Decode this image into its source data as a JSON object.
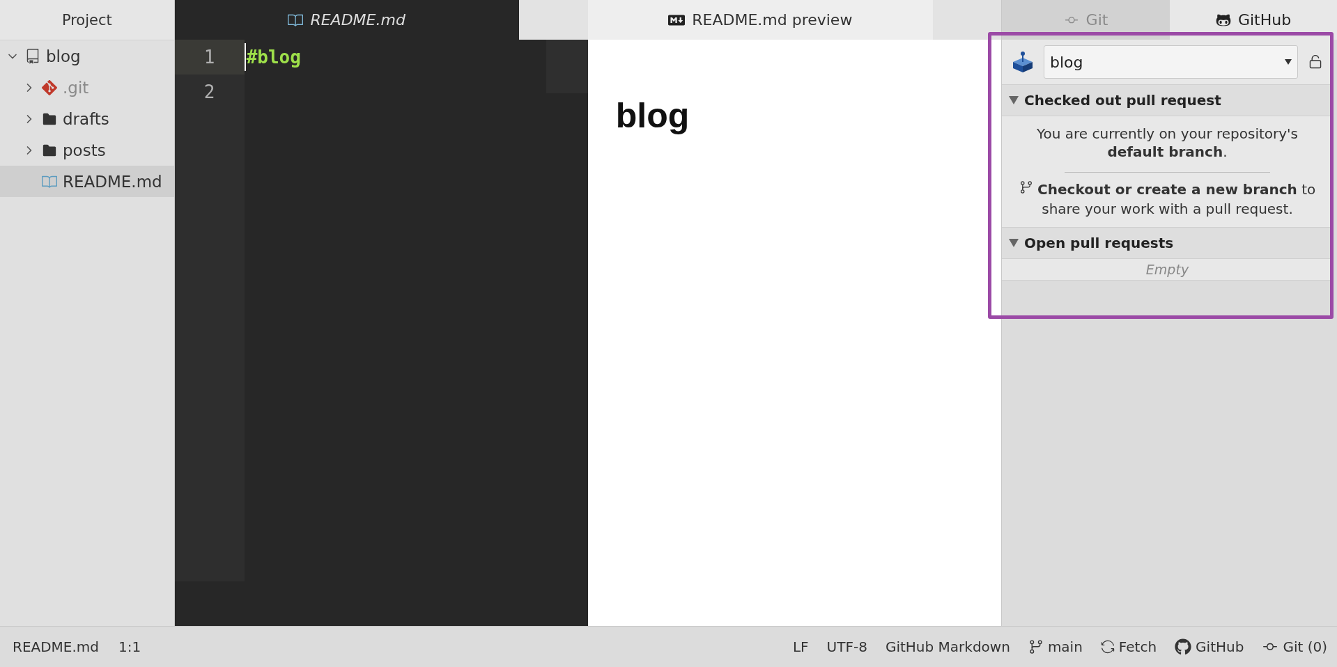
{
  "tree": {
    "header": "Project",
    "root": {
      "label": "blog",
      "expanded": true,
      "selected": false,
      "children": [
        {
          "label": ".git",
          "kind": "git",
          "expanded": false,
          "ignored": true,
          "selected": false
        },
        {
          "label": "drafts",
          "kind": "folder",
          "expanded": false,
          "ignored": false,
          "selected": false
        },
        {
          "label": "posts",
          "kind": "folder",
          "expanded": false,
          "ignored": false,
          "selected": false
        },
        {
          "label": "README.md",
          "kind": "file",
          "ignored": false,
          "selected": true
        }
      ]
    }
  },
  "editor": {
    "tab": {
      "label": "README.md",
      "pending": true,
      "selected": true
    },
    "lines": [
      {
        "number": "1",
        "text": "#blog",
        "current": true
      },
      {
        "number": "2",
        "current": false
      }
    ]
  },
  "preview": {
    "tab": {
      "label": "README.md preview",
      "selected": true
    },
    "heading": "blog"
  },
  "dock": {
    "tabs": [
      {
        "label": "Git",
        "kind": "git",
        "selected": false
      },
      {
        "label": "GitHub",
        "kind": "github",
        "selected": true
      }
    ],
    "repo_select": {
      "value": "blog"
    },
    "sections": [
      {
        "title": "Checked out pull request",
        "expanded": true,
        "message": "You are currently on your repository's **default branch**.",
        "action": "Checkout or create a new branch",
        "action_rest": "to share your work with a pull request."
      },
      {
        "title": "Open pull requests",
        "expanded": true,
        "empty": "Empty"
      }
    ]
  },
  "status_bar": {
    "left": [
      "README.md",
      "1:1"
    ],
    "right": [
      {
        "kind": "text",
        "label": "LF"
      },
      {
        "kind": "text",
        "label": "UTF-8"
      },
      {
        "kind": "text",
        "label": "GitHub Markdown"
      },
      {
        "kind": "branch",
        "label": "main"
      },
      {
        "kind": "fetch",
        "label": "Fetch"
      },
      {
        "kind": "github",
        "label": "GitHub"
      },
      {
        "kind": "git",
        "label": "Git (0)"
      }
    ]
  }
}
